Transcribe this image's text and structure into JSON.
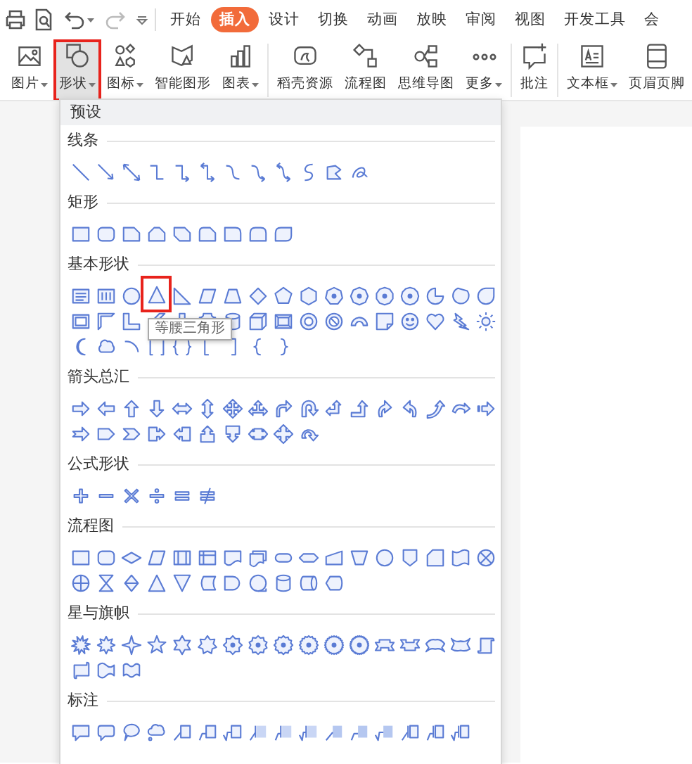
{
  "tabs": [
    {
      "label": "开始",
      "selected": false
    },
    {
      "label": "插入",
      "selected": true
    },
    {
      "label": "设计",
      "selected": false
    },
    {
      "label": "切换",
      "selected": false
    },
    {
      "label": "动画",
      "selected": false
    },
    {
      "label": "放映",
      "selected": false
    },
    {
      "label": "审阅",
      "selected": false
    },
    {
      "label": "视图",
      "selected": false
    },
    {
      "label": "开发工具",
      "selected": false
    },
    {
      "label": "会",
      "selected": false
    }
  ],
  "ribbon": [
    {
      "kind": "picture",
      "label": "图片",
      "has_menu": true,
      "highlighted": false
    },
    {
      "kind": "shapes",
      "label": "形状",
      "has_menu": true,
      "highlighted": true
    },
    {
      "kind": "icons",
      "label": "图标",
      "has_menu": true,
      "highlighted": false
    },
    {
      "kind": "smartart",
      "label": "智能图形",
      "has_menu": false,
      "highlighted": false
    },
    {
      "kind": "chart",
      "label": "图表",
      "has_menu": true,
      "highlighted": false
    },
    {
      "kind": "separator"
    },
    {
      "kind": "resources",
      "label": "稻壳资源",
      "has_menu": false,
      "highlighted": false
    },
    {
      "kind": "flowchart",
      "label": "流程图",
      "has_menu": false,
      "highlighted": false
    },
    {
      "kind": "mindmap",
      "label": "思维导图",
      "has_menu": false,
      "highlighted": false
    },
    {
      "kind": "more",
      "label": "更多",
      "has_menu": true,
      "highlighted": false
    },
    {
      "kind": "separator"
    },
    {
      "kind": "comment",
      "label": "批注",
      "has_menu": false,
      "highlighted": false
    },
    {
      "kind": "separator"
    },
    {
      "kind": "textbox",
      "label": "文本框",
      "has_menu": true,
      "highlighted": false
    },
    {
      "kind": "headerfooter",
      "label": "页眉页脚",
      "has_menu": false,
      "highlighted": false
    }
  ],
  "panel": {
    "header": "预设",
    "tooltip": "等腰三角形",
    "sections": [
      {
        "title": "线条",
        "shapes": [
          {
            "kind": "line",
            "highlighted": false
          },
          {
            "kind": "arrow-line",
            "highlighted": false
          },
          {
            "kind": "double-arrow-line",
            "highlighted": false
          },
          {
            "kind": "elbow-connector",
            "highlighted": false
          },
          {
            "kind": "elbow-arrow",
            "highlighted": false
          },
          {
            "kind": "elbow-double-arrow",
            "highlighted": false
          },
          {
            "kind": "curved-connector",
            "highlighted": false
          },
          {
            "kind": "curved-arrow",
            "highlighted": false
          },
          {
            "kind": "curved-double-arrow",
            "highlighted": false
          },
          {
            "kind": "s-curve",
            "highlighted": false
          },
          {
            "kind": "freeform",
            "highlighted": false
          },
          {
            "kind": "scribble",
            "highlighted": false
          }
        ]
      },
      {
        "title": "矩形",
        "shapes": [
          {
            "kind": "rectangle",
            "highlighted": false
          },
          {
            "kind": "rounded-rectangle",
            "highlighted": false
          },
          {
            "kind": "snip-corner-rectangle",
            "highlighted": false
          },
          {
            "kind": "snip-same-side-rectangle",
            "highlighted": false
          },
          {
            "kind": "snip-diagonal-rectangle",
            "highlighted": false
          },
          {
            "kind": "snip-round-rectangle",
            "highlighted": false
          },
          {
            "kind": "round-corner-rectangle",
            "highlighted": false
          },
          {
            "kind": "round-same-side-rectangle",
            "highlighted": false
          },
          {
            "kind": "round-diagonal-rectangle",
            "highlighted": false
          }
        ]
      },
      {
        "title": "基本形状",
        "shapes": [
          {
            "kind": "text-box",
            "highlighted": false
          },
          {
            "kind": "vertical-text-box",
            "highlighted": false
          },
          {
            "kind": "oval",
            "highlighted": false
          },
          {
            "kind": "triangle",
            "highlighted": true
          },
          {
            "kind": "right-triangle",
            "highlighted": false
          },
          {
            "kind": "parallelogram",
            "highlighted": false
          },
          {
            "kind": "trapezoid",
            "highlighted": false
          },
          {
            "kind": "diamond",
            "highlighted": false
          },
          {
            "kind": "pentagon",
            "highlighted": false
          },
          {
            "kind": "hexagon",
            "highlighted": false
          },
          {
            "kind": "heptagon",
            "highlighted": false
          },
          {
            "kind": "octagon",
            "highlighted": false
          },
          {
            "kind": "decagon",
            "highlighted": false
          },
          {
            "kind": "dodecagon",
            "highlighted": false
          },
          {
            "kind": "pie",
            "highlighted": false
          },
          {
            "kind": "chord",
            "highlighted": false
          },
          {
            "kind": "teardrop",
            "highlighted": false
          },
          {
            "kind": "frame",
            "highlighted": false
          },
          {
            "kind": "half-frame",
            "highlighted": false
          },
          {
            "kind": "l-shape",
            "highlighted": false
          },
          {
            "kind": "diagonal-stripe",
            "highlighted": false
          },
          {
            "kind": "cross",
            "highlighted": false
          },
          {
            "kind": "plaque",
            "highlighted": false
          },
          {
            "kind": "can",
            "highlighted": false
          },
          {
            "kind": "cube",
            "highlighted": false
          },
          {
            "kind": "bevel",
            "highlighted": false
          },
          {
            "kind": "donut",
            "highlighted": false
          },
          {
            "kind": "no-symbol",
            "highlighted": false
          },
          {
            "kind": "block-arc",
            "highlighted": false
          },
          {
            "kind": "folded-corner",
            "highlighted": false
          },
          {
            "kind": "smiley",
            "highlighted": false
          },
          {
            "kind": "heart",
            "highlighted": false
          },
          {
            "kind": "lightning",
            "highlighted": false
          },
          {
            "kind": "sun",
            "highlighted": false
          },
          {
            "kind": "moon",
            "highlighted": false
          },
          {
            "kind": "cloud",
            "highlighted": false
          },
          {
            "kind": "arc",
            "highlighted": false
          },
          {
            "kind": "bracket-pair",
            "highlighted": false
          },
          {
            "kind": "brace-pair",
            "highlighted": false
          },
          {
            "kind": "left-bracket",
            "highlighted": false
          },
          {
            "kind": "right-bracket",
            "highlighted": false
          },
          {
            "kind": "left-brace",
            "highlighted": false
          },
          {
            "kind": "right-brace",
            "highlighted": false
          }
        ]
      },
      {
        "title": "箭头总汇",
        "shapes": [
          {
            "kind": "right-arrow",
            "highlighted": false
          },
          {
            "kind": "left-arrow",
            "highlighted": false
          },
          {
            "kind": "up-arrow",
            "highlighted": false
          },
          {
            "kind": "down-arrow",
            "highlighted": false
          },
          {
            "kind": "left-right-arrow",
            "highlighted": false
          },
          {
            "kind": "up-down-arrow",
            "highlighted": false
          },
          {
            "kind": "quad-arrow",
            "highlighted": false
          },
          {
            "kind": "left-right-up-arrow",
            "highlighted": false
          },
          {
            "kind": "bent-arrow",
            "highlighted": false
          },
          {
            "kind": "u-turn-arrow",
            "highlighted": false
          },
          {
            "kind": "left-up-arrow",
            "highlighted": false
          },
          {
            "kind": "bent-up-arrow",
            "highlighted": false
          },
          {
            "kind": "curved-right-arrow",
            "highlighted": false
          },
          {
            "kind": "curved-left-arrow",
            "highlighted": false
          },
          {
            "kind": "curved-up-arrow",
            "highlighted": false
          },
          {
            "kind": "curved-down-arrow",
            "highlighted": false
          },
          {
            "kind": "striped-right-arrow",
            "highlighted": false
          },
          {
            "kind": "notched-right-arrow",
            "highlighted": false
          },
          {
            "kind": "home-plate",
            "highlighted": false
          },
          {
            "kind": "chevron",
            "highlighted": false
          },
          {
            "kind": "right-arrow-callout",
            "highlighted": false
          },
          {
            "kind": "left-arrow-callout",
            "highlighted": false
          },
          {
            "kind": "up-arrow-callout",
            "highlighted": false
          },
          {
            "kind": "down-arrow-callout",
            "highlighted": false
          },
          {
            "kind": "left-right-arrow-callout",
            "highlighted": false
          },
          {
            "kind": "quad-arrow-callout",
            "highlighted": false
          },
          {
            "kind": "circular-arrow",
            "highlighted": false
          }
        ]
      },
      {
        "title": "公式形状",
        "shapes": [
          {
            "kind": "plus",
            "highlighted": false
          },
          {
            "kind": "minus",
            "highlighted": false
          },
          {
            "kind": "multiply",
            "highlighted": false
          },
          {
            "kind": "divide",
            "highlighted": false
          },
          {
            "kind": "equal",
            "highlighted": false
          },
          {
            "kind": "not-equal",
            "highlighted": false
          }
        ]
      },
      {
        "title": "流程图",
        "shapes": [
          {
            "kind": "process",
            "highlighted": false
          },
          {
            "kind": "alternate-process",
            "highlighted": false
          },
          {
            "kind": "decision",
            "highlighted": false
          },
          {
            "kind": "data",
            "highlighted": false
          },
          {
            "kind": "predefined-process",
            "highlighted": false
          },
          {
            "kind": "internal-storage",
            "highlighted": false
          },
          {
            "kind": "document",
            "highlighted": false
          },
          {
            "kind": "multidocument",
            "highlighted": false
          },
          {
            "kind": "terminator",
            "highlighted": false
          },
          {
            "kind": "preparation",
            "highlighted": false
          },
          {
            "kind": "manual-input",
            "highlighted": false
          },
          {
            "kind": "manual-operation",
            "highlighted": false
          },
          {
            "kind": "connector",
            "highlighted": false
          },
          {
            "kind": "off-page-connector",
            "highlighted": false
          },
          {
            "kind": "card",
            "highlighted": false
          },
          {
            "kind": "punched-tape",
            "highlighted": false
          },
          {
            "kind": "summing-junction",
            "highlighted": false
          },
          {
            "kind": "or",
            "highlighted": false
          },
          {
            "kind": "collate",
            "highlighted": false
          },
          {
            "kind": "sort",
            "highlighted": false
          },
          {
            "kind": "extract",
            "highlighted": false
          },
          {
            "kind": "merge",
            "highlighted": false
          },
          {
            "kind": "stored-data",
            "highlighted": false
          },
          {
            "kind": "delay",
            "highlighted": false
          },
          {
            "kind": "sequential-access",
            "highlighted": false
          },
          {
            "kind": "magnetic-disk",
            "highlighted": false
          },
          {
            "kind": "direct-access",
            "highlighted": false
          },
          {
            "kind": "display",
            "highlighted": false
          }
        ]
      },
      {
        "title": "星与旗帜",
        "shapes": [
          {
            "kind": "explosion",
            "highlighted": false
          },
          {
            "kind": "explosion-small",
            "highlighted": false
          },
          {
            "kind": "star-4",
            "highlighted": false
          },
          {
            "kind": "star-5",
            "highlighted": false
          },
          {
            "kind": "star-6",
            "highlighted": false
          },
          {
            "kind": "star-7",
            "highlighted": false
          },
          {
            "kind": "star-8",
            "highlighted": false
          },
          {
            "kind": "star-10",
            "highlighted": false
          },
          {
            "kind": "star-12",
            "highlighted": false
          },
          {
            "kind": "star-16",
            "highlighted": false
          },
          {
            "kind": "star-24",
            "highlighted": false
          },
          {
            "kind": "star-32",
            "highlighted": false
          },
          {
            "kind": "ribbon-down",
            "highlighted": false
          },
          {
            "kind": "ribbon-up",
            "highlighted": false
          },
          {
            "kind": "curved-ribbon-down",
            "highlighted": false
          },
          {
            "kind": "curved-ribbon-up",
            "highlighted": false
          },
          {
            "kind": "vertical-scroll",
            "highlighted": false
          },
          {
            "kind": "horizontal-scroll",
            "highlighted": false
          },
          {
            "kind": "wave",
            "highlighted": false
          },
          {
            "kind": "double-wave",
            "highlighted": false
          }
        ]
      },
      {
        "title": "标注",
        "shapes": [
          {
            "kind": "rectangle-callout",
            "highlighted": false
          },
          {
            "kind": "rounded-callout",
            "highlighted": false
          },
          {
            "kind": "oval-callout",
            "highlighted": false
          },
          {
            "kind": "cloud-callout",
            "highlighted": false
          },
          {
            "kind": "line-callout",
            "highlighted": false
          },
          {
            "kind": "bent-line-callout",
            "highlighted": false
          },
          {
            "kind": "double-bent-line-callout",
            "highlighted": false
          },
          {
            "kind": "accent-callout",
            "highlighted": false
          },
          {
            "kind": "bent-accent-callout",
            "highlighted": false
          },
          {
            "kind": "double-bent-accent-callout",
            "highlighted": false
          },
          {
            "kind": "borderless-callout",
            "highlighted": false
          },
          {
            "kind": "bent-borderless-callout",
            "highlighted": false
          },
          {
            "kind": "double-bent-borderless-callout",
            "highlighted": false
          },
          {
            "kind": "accent-border-callout",
            "highlighted": false
          },
          {
            "kind": "bent-accent-border-callout",
            "highlighted": false
          },
          {
            "kind": "double-bent-accent-border-callout",
            "highlighted": false
          }
        ]
      }
    ]
  }
}
